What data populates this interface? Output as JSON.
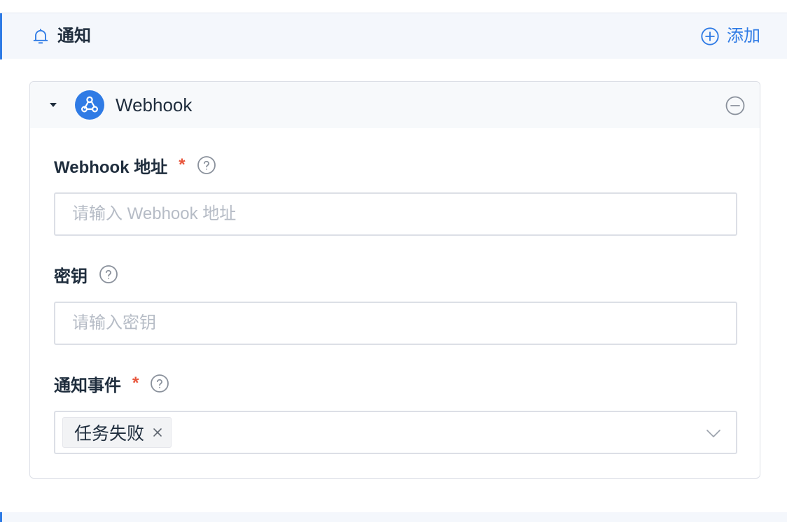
{
  "section": {
    "title": "通知",
    "add_label": "添加"
  },
  "card": {
    "title": "Webhook",
    "fields": {
      "url": {
        "label": "Webhook 地址",
        "required": "*",
        "placeholder": "请输入 Webhook 地址",
        "value": ""
      },
      "secret": {
        "label": "密钥",
        "placeholder": "请输入密钥",
        "value": ""
      },
      "events": {
        "label": "通知事件",
        "required": "*",
        "selected": [
          "任务失败"
        ]
      }
    }
  },
  "icons": {
    "section": "bell-icon",
    "add": "plus-circle-icon",
    "caret": "caret-down-icon",
    "logo": "webhook-icon",
    "remove": "minus-circle-icon",
    "help": "question-circle-icon",
    "tag_close": "close-icon",
    "dropdown": "chevron-down-icon"
  },
  "colors": {
    "accent": "#2f7be5",
    "required": "#e8553b",
    "header_bg": "#f4f7fc",
    "border": "#dcdfe6",
    "placeholder": "#b6bcc6"
  }
}
